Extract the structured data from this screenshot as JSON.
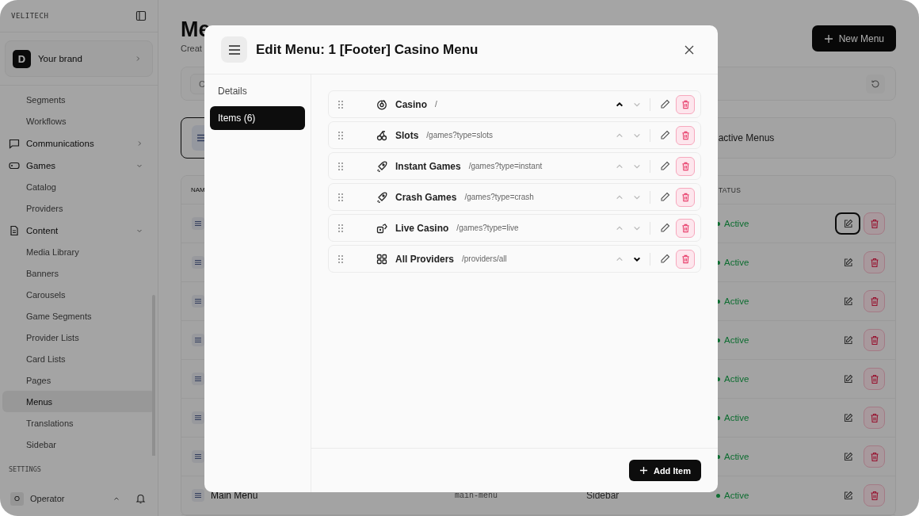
{
  "sidebar": {
    "brand_label": "VELITECH",
    "workspace": {
      "initial": "D",
      "name": "Your brand"
    },
    "items": [
      {
        "kind": "link",
        "label": "Segments",
        "selected": false
      },
      {
        "kind": "link",
        "label": "Workflows",
        "selected": false
      },
      {
        "kind": "chat",
        "label": "Communications",
        "selected": false,
        "expanded": false
      },
      {
        "kind": "gamepad",
        "label": "Games",
        "selected": false,
        "expanded": true,
        "children": [
          {
            "label": "Catalog",
            "selected": false
          },
          {
            "label": "Providers",
            "selected": false
          }
        ]
      },
      {
        "kind": "document",
        "label": "Content",
        "selected": false,
        "expanded": true,
        "children": [
          {
            "label": "Media Library",
            "selected": false
          },
          {
            "label": "Banners",
            "selected": false
          },
          {
            "label": "Carousels",
            "selected": false
          },
          {
            "label": "Game Segments",
            "selected": false
          },
          {
            "label": "Provider Lists",
            "selected": false
          },
          {
            "label": "Card Lists",
            "selected": false
          },
          {
            "label": "Pages",
            "selected": false
          },
          {
            "label": "Menus",
            "selected": true
          },
          {
            "label": "Translations",
            "selected": false
          },
          {
            "label": "Sidebar",
            "selected": false
          }
        ]
      }
    ],
    "section": "SETTINGS",
    "user": {
      "initial": "O",
      "name": "Operator"
    }
  },
  "page": {
    "title": "Me",
    "subtitle": "Creat",
    "new_button": "New Menu",
    "search": {
      "placeholder": "C"
    },
    "stats": [
      {
        "selected": true
      },
      {
        "label": "active Menus",
        "selected": false
      }
    ]
  },
  "table": {
    "columns": [
      "NAM",
      "TATUS"
    ],
    "rows": [
      {
        "status": "Active",
        "focused": true
      },
      {
        "status": "Active",
        "focused": false
      },
      {
        "status": "Active",
        "focused": false
      },
      {
        "status": "Active",
        "focused": false
      },
      {
        "status": "Active",
        "focused": false
      },
      {
        "status": "Active",
        "focused": false
      },
      {
        "status": "Active",
        "focused": false
      },
      {
        "name": "Main Menu",
        "slug": "main-menu",
        "location": "Sidebar",
        "status": "Active",
        "focused": false
      }
    ]
  },
  "modal": {
    "title": "Edit Menu: 1 [Footer] Casino Menu",
    "tabs": [
      {
        "label": "Details",
        "selected": false
      },
      {
        "label": "Items (6)",
        "selected": true
      }
    ],
    "items": [
      {
        "kind": "chip",
        "name": "Casino",
        "path": "/",
        "up_active": true,
        "down_active": false
      },
      {
        "kind": "cherry",
        "name": "Slots",
        "path": "/games?type=slots",
        "up_active": false,
        "down_active": false
      },
      {
        "kind": "rocket",
        "name": "Instant Games",
        "path": "/games?type=instant",
        "up_active": false,
        "down_active": false
      },
      {
        "kind": "rocket",
        "name": "Crash Games",
        "path": "/games?type=crash",
        "up_active": false,
        "down_active": false
      },
      {
        "kind": "dice",
        "name": "Live Casino",
        "path": "/games?type=live",
        "up_active": false,
        "down_active": false
      },
      {
        "kind": "grid",
        "name": "All Providers",
        "path": "/providers/all",
        "up_active": false,
        "down_active": true
      }
    ],
    "add_button": "Add Item"
  }
}
